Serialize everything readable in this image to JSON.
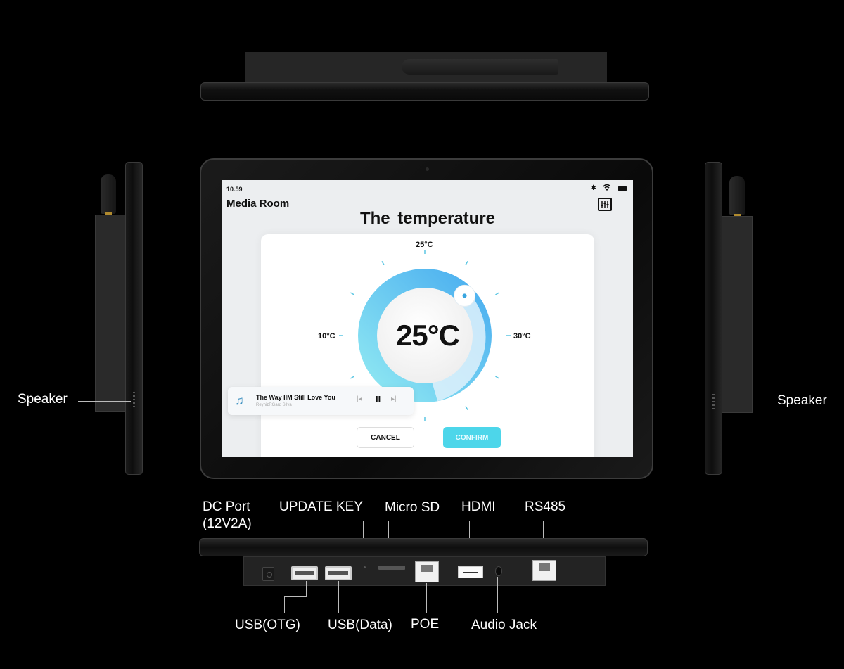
{
  "device_views": {
    "top": "top-view",
    "left": "left-side-view",
    "right": "right-side-view",
    "front": "front-view",
    "bottom": "bottom-view"
  },
  "side_labels": {
    "left_speaker": "Speaker",
    "right_speaker": "Speaker"
  },
  "port_labels": {
    "dc_port": "DC Port",
    "dc_port_spec": "(12V2A)",
    "update_key": "UPDATE KEY",
    "micro_sd": "Micro SD",
    "hdmi": "HDMI",
    "rs485": "RS485",
    "usb_otg": "USB(OTG)",
    "usb_data": "USB(Data)",
    "poe": "POE",
    "audio_jack": "Audio Jack"
  },
  "screen": {
    "status_bar": {
      "time": "10.59",
      "icons": [
        "bluetooth-icon",
        "wifi-icon",
        "battery-icon"
      ],
      "bluetooth_glyph": "✱",
      "wifi_glyph": "ᯤ"
    },
    "room_title": "Media Room",
    "settings_icon_glyph": "|†|",
    "page_title": "The  temperature",
    "dial": {
      "current_value": "25°C",
      "top_label": "25°C",
      "left_label": "10°C",
      "right_label": "30°C",
      "min": 10,
      "max": 30,
      "value": 25,
      "gradient_start": "#8fe8f2",
      "gradient_end": "#4aaef0"
    },
    "buttons": {
      "cancel": "CANCEL",
      "confirm": "CONFIRM",
      "confirm_color": "#4dd6ea"
    },
    "media_player": {
      "song_title": "The Way IIM Still Love You",
      "artist": "ReynizRGard Silva",
      "note_glyph": "♫",
      "prev_glyph": "|◂",
      "pause_glyph": "II",
      "next_glyph": "▸|"
    }
  }
}
